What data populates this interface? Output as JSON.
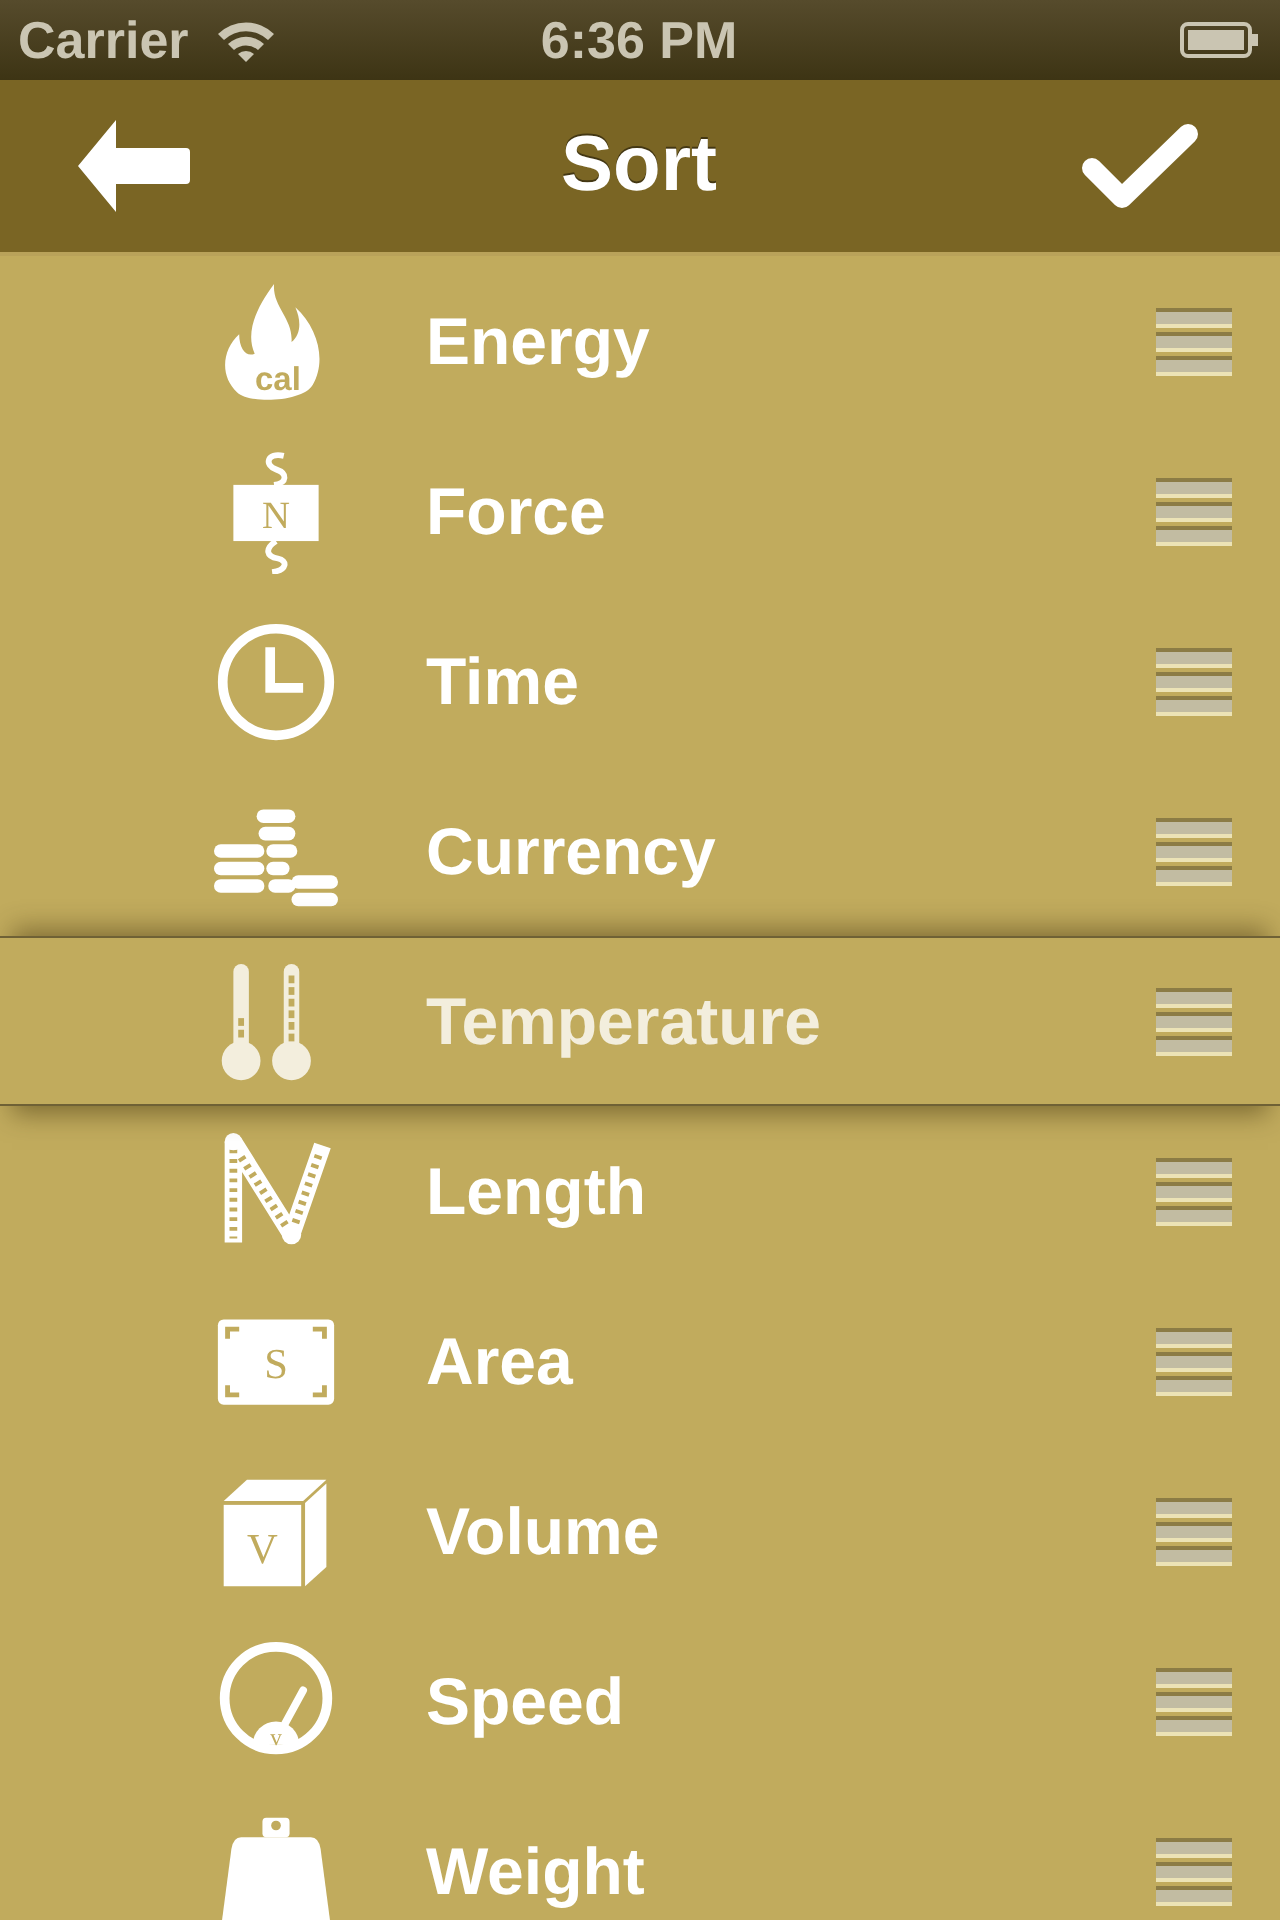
{
  "status_bar": {
    "carrier": "Carrier",
    "time": "6:36 PM"
  },
  "nav_bar": {
    "title": "Sort"
  },
  "rows": [
    {
      "kind": "energy",
      "label": "Energy",
      "icon_label": "cal",
      "dragging": false
    },
    {
      "kind": "force",
      "label": "Force",
      "icon_label": "N",
      "dragging": false
    },
    {
      "kind": "time",
      "label": "Time",
      "dragging": false
    },
    {
      "kind": "currency",
      "label": "Currency",
      "dragging": false
    },
    {
      "kind": "temperature",
      "label": "Temperature",
      "dragging": true
    },
    {
      "kind": "length",
      "label": "Length",
      "dragging": false
    },
    {
      "kind": "area",
      "label": "Area",
      "icon_label": "S",
      "dragging": false
    },
    {
      "kind": "volume",
      "label": "Volume",
      "icon_label": "V",
      "dragging": false
    },
    {
      "kind": "speed",
      "label": "Speed",
      "icon_label": "v",
      "dragging": false
    },
    {
      "kind": "weight",
      "label": "Weight",
      "dragging": false
    }
  ]
}
